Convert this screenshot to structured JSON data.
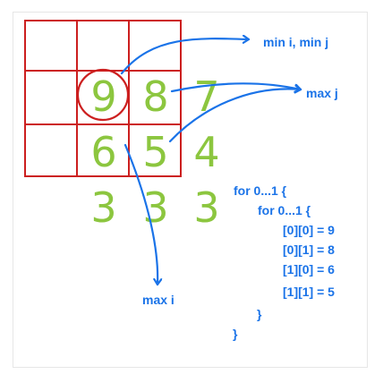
{
  "grid_digits": [
    "9",
    "8",
    "7",
    "6",
    "5",
    "4",
    "3",
    "3",
    "3"
  ],
  "labels": {
    "min_i_min_j": "min i, min j",
    "max_j": "max j",
    "max_i": "max i"
  },
  "code": {
    "outer_for": "for 0...1 {",
    "inner_for": "for 0...1 {",
    "line_00": "[0][0] = 9",
    "line_01": "[0][1] = 8",
    "line_10": "[1][0] = 6",
    "line_11": "[1][1] = 5",
    "inner_close": "}",
    "outer_close": "}"
  },
  "colors": {
    "grid": "#cc1f1f",
    "digit": "#8cc63f",
    "arrow": "#1a73e8"
  }
}
